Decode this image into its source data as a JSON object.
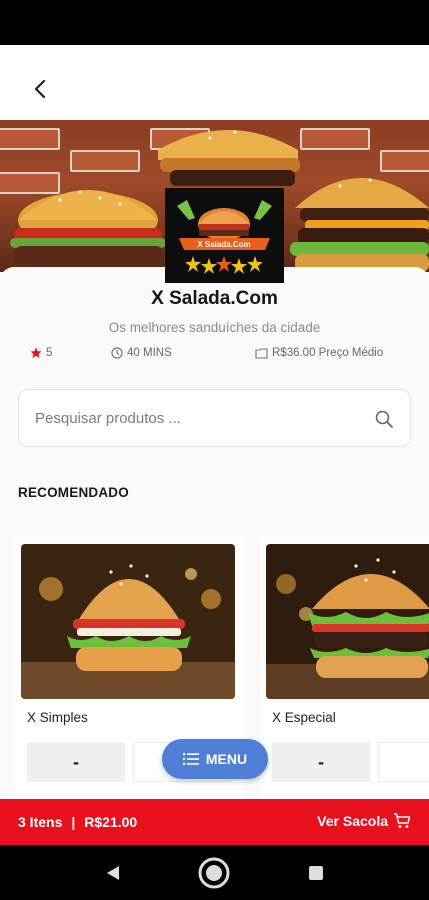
{
  "store": {
    "name": "X Salada.Com",
    "description": "Os melhores sanduíches da cidade",
    "rating": "5",
    "delivery_time": "40 MINS",
    "avg_price": "R$36.00 Preço Médio",
    "logo_text": "X Salada.Com"
  },
  "search": {
    "placeholder": "Pesquisar produtos ..."
  },
  "section": {
    "title": "RECOMENDADO"
  },
  "products": [
    {
      "name": "X Simples",
      "minus_label": "-"
    },
    {
      "name": "X Especial",
      "minus_label": "-"
    }
  ],
  "menu_button": {
    "label": "MENU"
  },
  "cart": {
    "items": "3 Itens",
    "separator": "|",
    "total": "R$21.00",
    "view_label": "Ver Sacola"
  },
  "colors": {
    "accent_red": "#e8101d",
    "menu_blue": "#4f7fd7",
    "star": "#e8101d"
  },
  "icons": [
    "back-arrow-icon",
    "star-icon",
    "clock-icon",
    "tag-icon",
    "search-icon",
    "menu-list-icon",
    "bag-icon",
    "nav-back-icon",
    "nav-home-icon",
    "nav-recents-icon"
  ]
}
